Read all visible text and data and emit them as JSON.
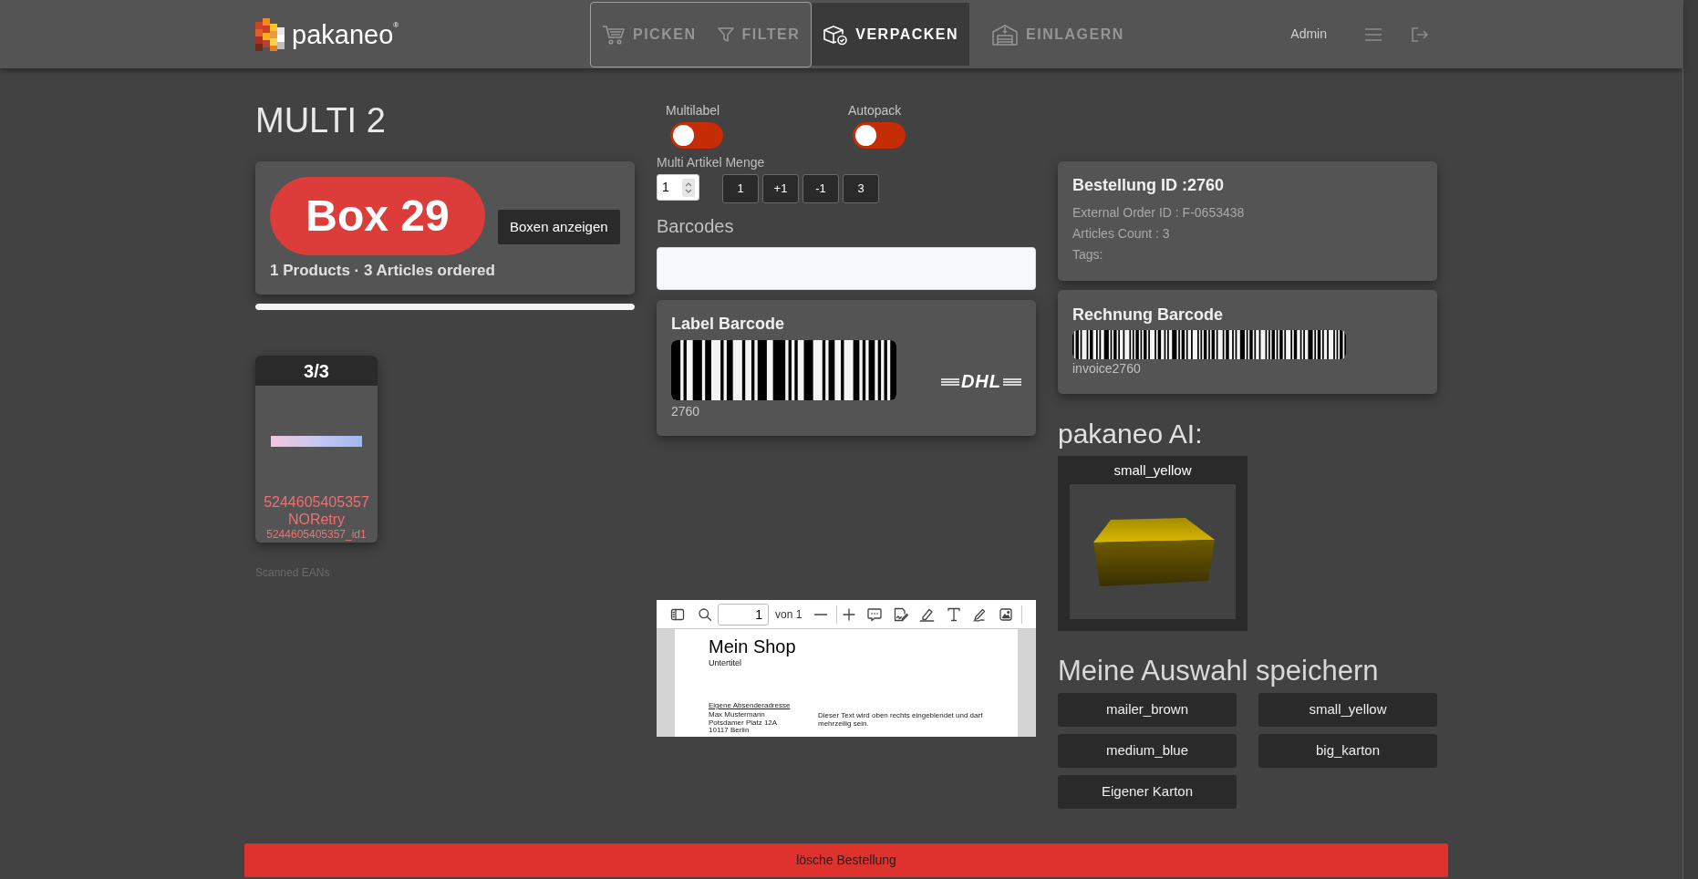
{
  "header": {
    "logo": "pakaneo$^{®}$",
    "nav_groups": [
      {
        "framed": true,
        "tabs": [
          {
            "label": "PICKEN",
            "selected": false,
            "disabled": true
          },
          {
            "label": "FILTER",
            "selected": false,
            "disabled": true
          }
        ]
      },
      {
        "framed": false,
        "tabs": [
          {
            "label": "VERPACKEN",
            "selected": true,
            "disabled": false
          },
          {
            "label": "EINLAGERN",
            "selected": false,
            "disabled": true
          }
        ]
      }
    ],
    "user": "Admin"
  },
  "title": "MULTI 2",
  "box_card": {
    "box": "Box 29",
    "button": "Boxen anzeigen",
    "summary": "1 Products · 3 Articles ordered"
  },
  "progress": {
    "level": 1
  },
  "products": [
    {
      "count": "3/3",
      "ean": "5244605405357",
      "status": "NORetry",
      "article_id": "5244605405357_id1"
    }
  ],
  "scanned_label": "Scanned EANs",
  "toggles": [
    {
      "label": "Multilabel",
      "on": false
    },
    {
      "label": "Autopack",
      "on": false
    }
  ],
  "quantity": {
    "label": "Multi Artikel Menge",
    "value": "1",
    "buttons": [
      "1",
      "+1",
      "-1",
      "3"
    ]
  },
  "barcodes": {
    "label": "Barcodes"
  },
  "label_barcode": {
    "title": "Label Barcode",
    "code": "2760",
    "carrier": "DHL"
  },
  "pdf_viewer": {
    "page": "1",
    "page_count": "von 1",
    "document": {
      "title": "Mein Shop",
      "subtitle": "Untertitel",
      "sender_line": "Eigene Absenderadresse",
      "address": [
        "Max Mustermann",
        "Potsdamer Platz 12A",
        "10117 Berlin"
      ],
      "note": "Dieser Text wird oben rechts eingeblendet und darf mehrzeilig sein."
    }
  },
  "order": {
    "title": "Bestellung ID :2760",
    "lines": [
      "External Order ID : F-0653438",
      "Articles Count : 3",
      "Tags:"
    ]
  },
  "invoice_barcode": {
    "title": "Rechnung Barcode",
    "code": "invoice2760"
  },
  "ai": {
    "heading": "pakaneo AI:",
    "suggestion": "small_yellow"
  },
  "save_selection": {
    "heading": "Meine Auswahl speichern",
    "options": [
      "mailer_brown",
      "small_yellow",
      "medium_blue",
      "big_karton",
      "Eigener Karton"
    ]
  },
  "delete_button": "lösche Bestellung"
}
